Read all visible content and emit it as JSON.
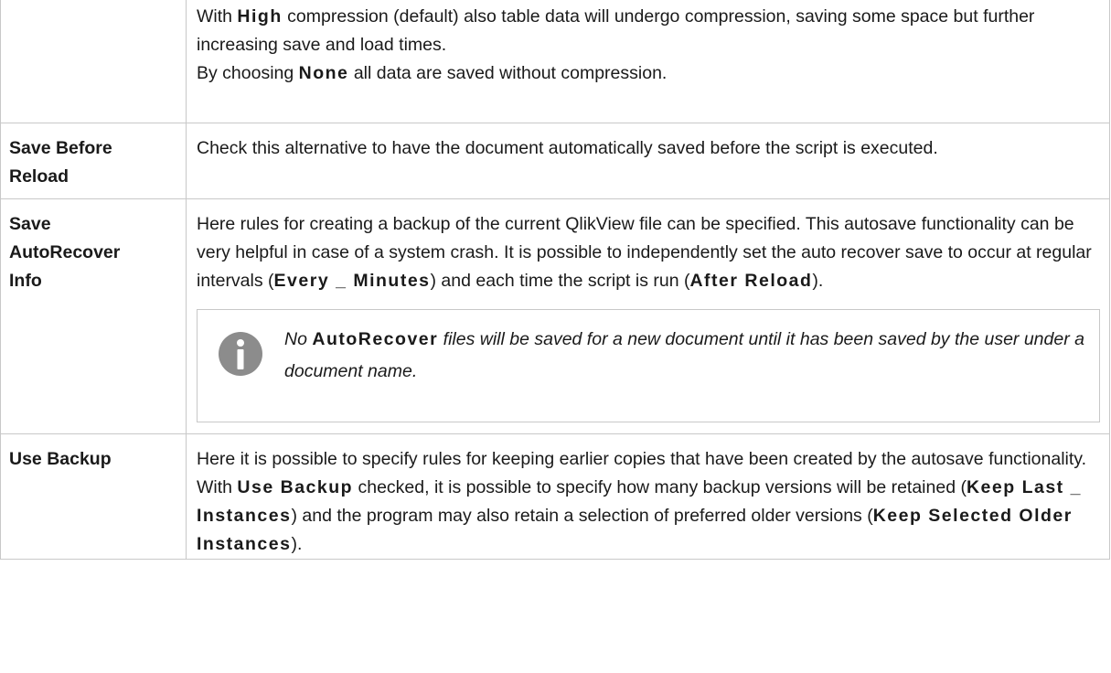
{
  "rows": [
    {
      "term": "",
      "desc": {
        "line1_pre": "With ",
        "line1_kw": "High",
        "line1_post": " compression (default) also table data will undergo compression, saving some space but further increasing save and load times.",
        "line2_pre": "By choosing ",
        "line2_kw": "None",
        "line2_post": " all data are saved without compression."
      }
    },
    {
      "term_line1": "Save Before",
      "term_line2": "Reload",
      "desc": "Check this alternative to have the document automatically saved before the script is executed."
    },
    {
      "term_line1": "Save",
      "term_line2": "AutoRecover",
      "term_line3": "Info",
      "desc": {
        "pre": "Here rules for creating a backup of the current QlikView file can be specified. This autosave functionality can be very helpful in case of a system crash. It is possible to independently set the auto recover save to occur at regular intervals (",
        "kw1": "Every _ Minutes",
        "mid": ") and each time the script is run (",
        "kw2": "After Reload",
        "post": ")."
      },
      "note": {
        "icon": "info-icon",
        "pre": "No ",
        "kw": "AutoRecover",
        "post": " files will be saved for a new document until it has been saved by the user under a document name."
      }
    },
    {
      "term": "Use Backup",
      "desc": {
        "pre": "Here it is possible to specify rules for keeping earlier copies that have been created by the autosave functionality. With ",
        "kw1": "Use Backup",
        "mid1": " checked, it is possible to specify how many backup versions will be retained (",
        "kw2": "Keep Last _ Instances",
        "mid2": ") and the program may also retain a selection of preferred older versions (",
        "kw3": "Keep Selected Older Instances",
        "post": ")."
      }
    }
  ],
  "colors": {
    "border": "#c8c8c8",
    "text": "#1a1a1a",
    "icon_fill": "#8c8c8c"
  }
}
